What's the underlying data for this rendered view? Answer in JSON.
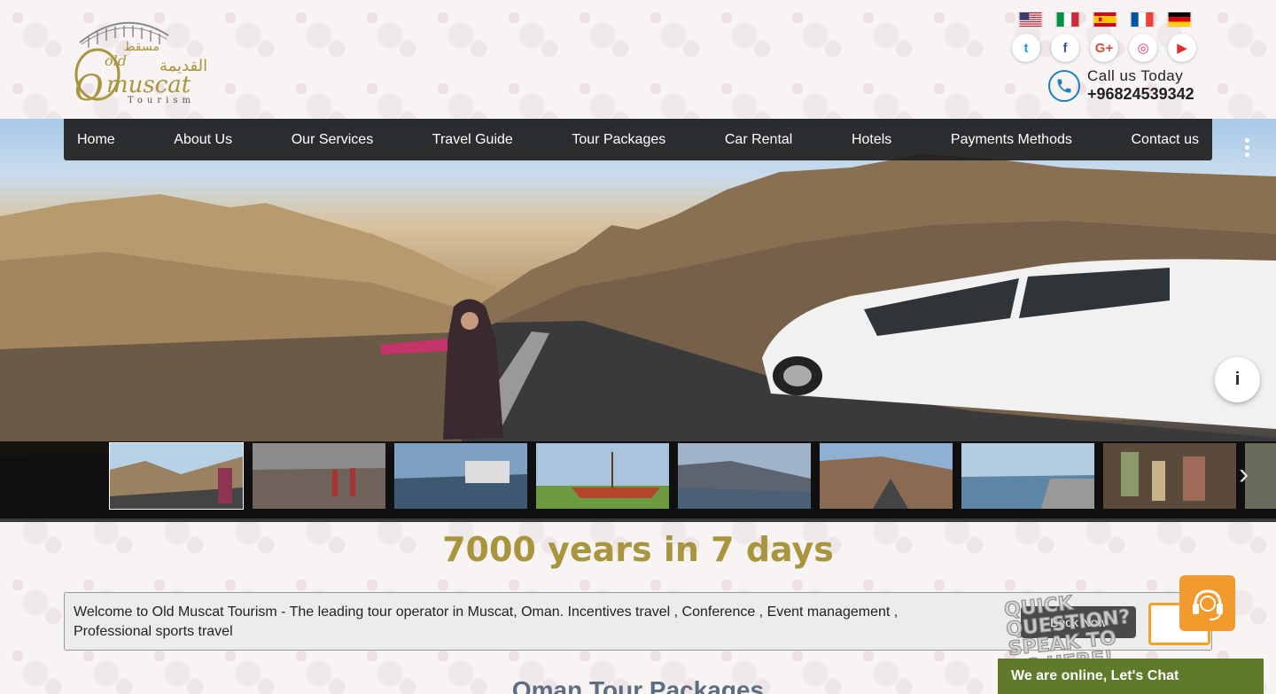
{
  "logo": {
    "text": "Old muscat",
    "sub": "Tourism",
    "arabic": "مسقط القديمة"
  },
  "languages": [
    {
      "name": "english-flag-icon"
    },
    {
      "name": "italian-flag-icon"
    },
    {
      "name": "spanish-flag-icon"
    },
    {
      "name": "french-flag-icon"
    },
    {
      "name": "german-flag-icon"
    }
  ],
  "social": [
    {
      "name": "twitter-icon",
      "glyph": "t",
      "color": "#1da1f2"
    },
    {
      "name": "facebook-icon",
      "glyph": "f",
      "color": "#3b5998"
    },
    {
      "name": "google-plus-icon",
      "glyph": "G+",
      "color": "#dd4b39"
    },
    {
      "name": "instagram-icon",
      "glyph": "◎",
      "color": "#e1306c"
    },
    {
      "name": "youtube-icon",
      "glyph": "▶",
      "color": "#e52d27"
    }
  ],
  "contact": {
    "call_label": "Call us Today",
    "phone": "+96824539342"
  },
  "nav": {
    "home": "Home",
    "about": "About Us",
    "services": "Our Services",
    "guide": "Travel Guide",
    "packages": "Tour Packages",
    "car": "Car Rental",
    "hotels": "Hotels",
    "payments": "Payments Methods",
    "contact": "Contact us"
  },
  "hero": {
    "info_label": "i",
    "next_label": "›"
  },
  "tagline": "7000 years in 7 days",
  "welcome_text": "Welcome to Old Muscat Tourism - The leading tour operator in Muscat, Oman. Incentives travel , Conference , Event management , Professional sports travel",
  "book_now": "Book Now",
  "quick_question": "QUICK QUESTION? SPEAK TO US HERE!",
  "chat_bar": "We are online, Let's Chat",
  "section_heading": "Oman Tour Packages",
  "colors": {
    "accent_gold": "#a8953e",
    "nav_bg": "#1e1e1e",
    "chat_green": "#5f7a2a",
    "chat_orange": "#f29a2e"
  }
}
